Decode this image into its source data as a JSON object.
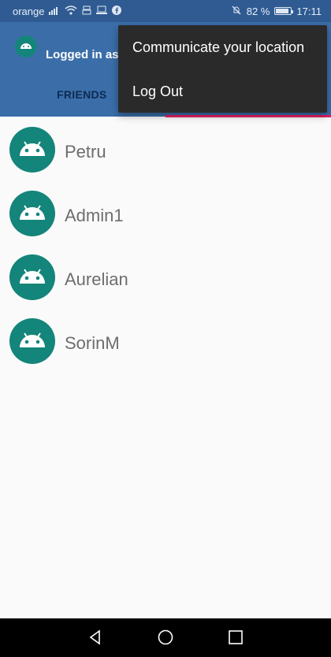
{
  "status_bar": {
    "carrier": "orange",
    "battery_percent": "82 %",
    "battery_level": 0.82,
    "time": "17:11",
    "icons": [
      "signal-icon",
      "wifi-icon",
      "usb-icon",
      "laptop-icon",
      "facebook-icon",
      "mute-icon",
      "battery-icon"
    ]
  },
  "app_bar": {
    "title": "Logged in as",
    "tabs": [
      {
        "label": "FRIENDS",
        "selected": false
      }
    ],
    "tab_indicator_color": "#e91e63",
    "background_color": "#3b6ea9"
  },
  "menu": {
    "items": [
      {
        "label": "Communicate your location"
      },
      {
        "label": "Log Out"
      }
    ]
  },
  "friends": [
    {
      "name": "Petru"
    },
    {
      "name": "Admin1"
    },
    {
      "name": "Aurelian"
    },
    {
      "name": "SorinM"
    }
  ],
  "avatar_color": "#14857a",
  "nav_bar": {
    "icons": [
      "back-icon",
      "home-icon",
      "recents-icon"
    ]
  }
}
